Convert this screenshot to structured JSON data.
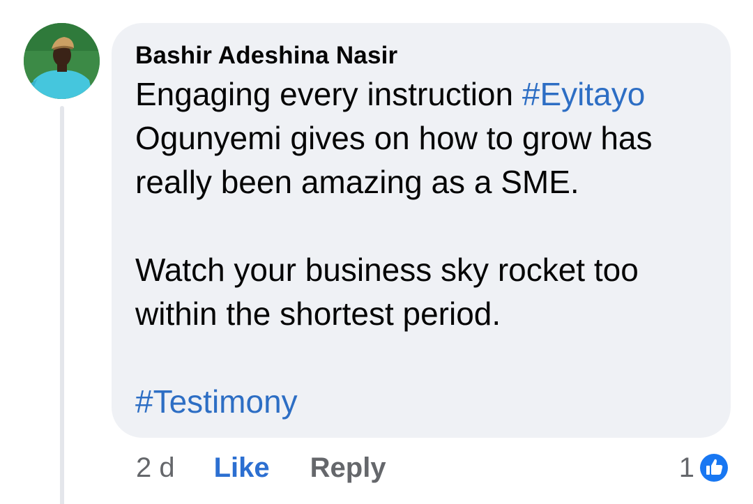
{
  "comment": {
    "author": "Bashir Adeshina Nasir",
    "paragraphs": [
      {
        "segments": [
          {
            "text": "Engaging every instruction ",
            "type": "text"
          },
          {
            "text": "#Eyitayo",
            "type": "hashtag"
          },
          {
            "text": " Ogunyemi gives on how to grow has really been amazing as a SME.",
            "type": "text"
          }
        ]
      },
      {
        "segments": [
          {
            "text": "Watch your business sky rocket too within the shortest period.",
            "type": "text"
          }
        ]
      },
      {
        "segments": [
          {
            "text": "#Testimony",
            "type": "hashtag"
          }
        ]
      }
    ],
    "time": "2 d",
    "like_label": "Like",
    "reply_label": "Reply",
    "reaction_count": "1",
    "reaction_icon": "thumbs-up-icon"
  },
  "colors": {
    "bubble": "#eff1f5",
    "hashtag": "#2d6ec4",
    "like": "#2c6fd1",
    "muted": "#65676b",
    "reaction_badge": "#1877f2"
  }
}
